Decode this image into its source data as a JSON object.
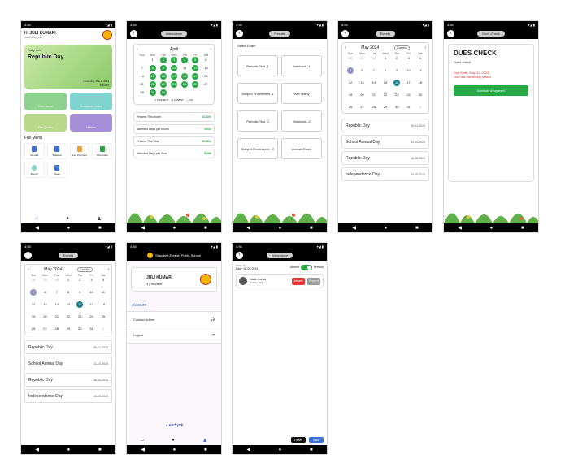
{
  "status": {
    "time": "4:55",
    "icons": "◉ ⚙ ✕",
    "right": "▾◢ ▮"
  },
  "school": {
    "name": "Standard English Public School"
  },
  "home": {
    "greeting": "Hi JULI KUMARI",
    "sub_greeting": "Have a nice day!",
    "banner": {
      "label": "Daily Info",
      "title": "Republic Day",
      "date": "Upcoming: May 2, 2024",
      "time": "8:30 PM"
    },
    "tiles": [
      "Attendance",
      "Homework Notes",
      "Fee Details",
      "Notices"
    ],
    "menu_title": "Full Menu",
    "menu": [
      "Results",
      "Syllabus",
      "Fee Payment",
      "Time Table",
      "Events",
      "Dues"
    ]
  },
  "attendance": {
    "pill": "Attendance",
    "month": "April",
    "weekdays": [
      "Sun",
      "Mon",
      "Tue",
      "Wed",
      "Thu",
      "Fri",
      "Sat"
    ],
    "legend": [
      "PRESENT",
      "ABSENT",
      "N/A"
    ],
    "stats": [
      {
        "label": "Present This Month",
        "value": "83.33%"
      },
      {
        "label": "Attended Days per Month",
        "value": "20/24"
      },
      {
        "label": "Present This Year",
        "value": "86.66%"
      },
      {
        "label": "Attended Days per Year",
        "value": "52/60"
      }
    ]
  },
  "exams": {
    "pill": "Results",
    "heading": "Select Exam",
    "items": [
      "Periodic Test -1",
      "Notebook -1",
      "Subject Enrichment -1",
      "Half Yearly",
      "Periodic Test -2",
      "Notebook -2",
      "Subject Enrichment - 2",
      "Annual Exam"
    ]
  },
  "events": {
    "pill": "Events",
    "month": "May 2024",
    "view": "2 weeks",
    "weekdays": [
      "Sun",
      "Mon",
      "Tue",
      "Wed",
      "Thu",
      "Fri",
      "Sat"
    ],
    "holidays": [
      {
        "name": "Republic Day",
        "date": "26-01-2024"
      },
      {
        "name": "School Annual Day",
        "date": "11-04-2024"
      },
      {
        "name": "Republic Day",
        "date": "16-05-2024"
      },
      {
        "name": "Independence Day",
        "date": "15-08-2024"
      }
    ]
  },
  "dues": {
    "pill": "Dues Check",
    "title": "DUES CHECK",
    "sub": "Dues check",
    "due_date": "Due Date: May 31, 2024",
    "warning": "Due Date has already passed",
    "button": "Download Assignment"
  },
  "profile": {
    "name": "JULI KUMARI",
    "role": "3 | Student",
    "section": "Account",
    "items": [
      "Contact Admin",
      "Logout"
    ],
    "brand": "eadtynk"
  },
  "mark": {
    "pill": "Attendance",
    "class": "Class: 3",
    "date": "Date: 06-05-2024",
    "absent": "Absent",
    "present": "Present",
    "student": "Harsh Kumar",
    "roll": "Roll No: 111",
    "reset": "Reset",
    "save": "Save"
  },
  "nav": {
    "back": "◀",
    "home": "●",
    "recent": "■"
  },
  "colors": {
    "green": "#27a844",
    "teal": "#1d7a8a",
    "purple": "#8f93c9",
    "red": "#e53935"
  }
}
